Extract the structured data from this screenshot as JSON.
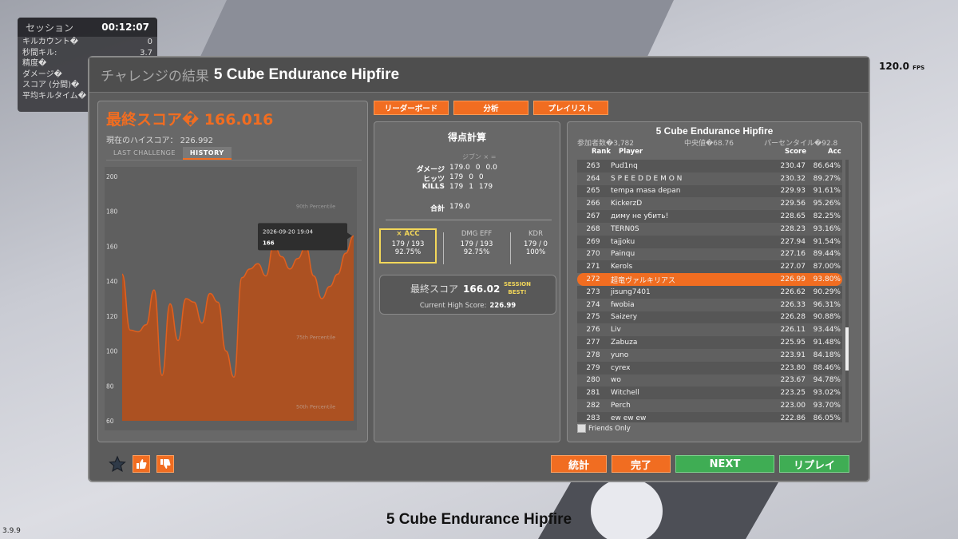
{
  "session": {
    "title": "セッション",
    "time": "00:12:07",
    "rows": [
      {
        "label": "キルカウント�",
        "value": "0"
      },
      {
        "label": "秒間キル:",
        "value": "3.7"
      },
      {
        "label": "精度�",
        "value": ""
      },
      {
        "label": "ダメージ�",
        "value": ""
      },
      {
        "label": "スコア (分間)�",
        "value": ""
      },
      {
        "label": "平均キルタイム�",
        "value": ""
      }
    ]
  },
  "fps": {
    "value": "120.0",
    "unit": "FPS"
  },
  "version": "3.9.9",
  "footer_title": "5 Cube Endurance Hipfire",
  "header": {
    "label": "チャレンジの結果",
    "scenario": "5 Cube Endurance Hipfire"
  },
  "left": {
    "final_score_label": "最終スコア� 166.016",
    "high_score": "現在のハイスコア： 226.992",
    "tabs": [
      "LAST CHALLENGE",
      "HISTORY"
    ],
    "active_tab": "HISTORY"
  },
  "chart_data": {
    "type": "area",
    "y_ticks": [
      "200",
      "180",
      "160",
      "140",
      "120",
      "100",
      "80",
      "60"
    ],
    "ylim": [
      60,
      200
    ],
    "percentile_labels": [
      "90th Percentile",
      "75th Percentile",
      "50th Percentile"
    ],
    "percentile_values": [
      182,
      107,
      67
    ],
    "values": [
      144,
      112,
      111,
      115,
      135,
      86,
      127,
      106,
      130,
      128,
      116,
      133,
      128,
      100,
      85,
      142,
      147,
      150,
      143,
      161,
      154,
      147,
      153,
      160,
      143,
      130,
      137,
      144,
      156,
      166
    ],
    "tooltip": {
      "date": "2026-09-20 19:04",
      "value": "166"
    },
    "colors": {
      "fill": "#b5501c",
      "line": "#e0601f"
    }
  },
  "nav_buttons": [
    "リーダーボード",
    "分析",
    "プレイリスト"
  ],
  "calc": {
    "title": "得点計算",
    "header": "ジブン  ×  =",
    "rows": [
      {
        "label": "ダメージ",
        "v": [
          "179.0",
          "0",
          "0.0"
        ]
      },
      {
        "label": "ヒッツ",
        "v": [
          "179",
          "0",
          "0"
        ]
      },
      {
        "label": "KILLS",
        "v": [
          "179",
          "1",
          "179"
        ]
      }
    ],
    "total_label": "合計",
    "total_value": "179.0"
  },
  "stats": [
    {
      "head": "× ACC",
      "line1": "179 / 193",
      "line2": "92.75%"
    },
    {
      "head": "DMG EFF",
      "line1": "179 / 193",
      "line2": "92.75%"
    },
    {
      "head": "KDR",
      "line1": "179 / 0",
      "line2": "100%"
    }
  ],
  "final": {
    "label": "最終スコア",
    "score": "166.02",
    "best": "SESSION BEST!",
    "high_label": "Current High Score:",
    "high_value": "226.99"
  },
  "leaderboard": {
    "title": "5 Cube Endurance Hipfire",
    "participants": "参加者数�3,782",
    "median": "中央値�68.76",
    "percentile": "パーセンタイル�92.8",
    "cols": [
      "Rank",
      "Player",
      "Score",
      "Acc"
    ],
    "rows": [
      {
        "rank": "263",
        "player": "Pud1nq",
        "score": "230.47",
        "acc": "86.64%"
      },
      {
        "rank": "264",
        "player": "S P E E D D E M O N",
        "score": "230.32",
        "acc": "89.27%"
      },
      {
        "rank": "265",
        "player": "tempa masa depan",
        "score": "229.93",
        "acc": "91.61%"
      },
      {
        "rank": "266",
        "player": "KickerzD",
        "score": "229.56",
        "acc": "95.26%"
      },
      {
        "rank": "267",
        "player": "диму не убить!",
        "score": "228.65",
        "acc": "82.25%"
      },
      {
        "rank": "268",
        "player": "TERN0S",
        "score": "228.23",
        "acc": "93.16%"
      },
      {
        "rank": "269",
        "player": "tajjoku",
        "score": "227.94",
        "acc": "91.54%"
      },
      {
        "rank": "270",
        "player": "Painqu",
        "score": "227.16",
        "acc": "89.44%"
      },
      {
        "rank": "271",
        "player": "Kerols",
        "score": "227.07",
        "acc": "87.00%"
      },
      {
        "rank": "272",
        "player": "超竜ヴァルキリアス",
        "score": "226.99",
        "acc": "93.80%",
        "me": true
      },
      {
        "rank": "273",
        "player": "jisung7401",
        "score": "226.62",
        "acc": "90.29%"
      },
      {
        "rank": "274",
        "player": "fwobia",
        "score": "226.33",
        "acc": "96.31%"
      },
      {
        "rank": "275",
        "player": "Saizery",
        "score": "226.28",
        "acc": "90.88%"
      },
      {
        "rank": "276",
        "player": "Liv",
        "score": "226.11",
        "acc": "93.44%"
      },
      {
        "rank": "277",
        "player": "Zabuza",
        "score": "225.95",
        "acc": "91.48%"
      },
      {
        "rank": "278",
        "player": "yuno",
        "score": "223.91",
        "acc": "84.18%"
      },
      {
        "rank": "279",
        "player": "cyrex",
        "score": "223.80",
        "acc": "88.46%"
      },
      {
        "rank": "280",
        "player": "wo",
        "score": "223.67",
        "acc": "94.78%"
      },
      {
        "rank": "281",
        "player": "Witchell",
        "score": "223.25",
        "acc": "93.02%"
      },
      {
        "rank": "282",
        "player": "Perch",
        "score": "223.00",
        "acc": "93.70%"
      },
      {
        "rank": "283",
        "player": "ew ew ew",
        "score": "222.86",
        "acc": "86.05%"
      }
    ],
    "friends_only": "Friends Only"
  },
  "bottom": {
    "stats": "統計",
    "done": "完了",
    "next": "NEXT",
    "replay": "リプレイ"
  },
  "icons": {
    "star": "star-icon",
    "like": "thumbs-up-icon",
    "dislike": "thumbs-down-icon"
  }
}
